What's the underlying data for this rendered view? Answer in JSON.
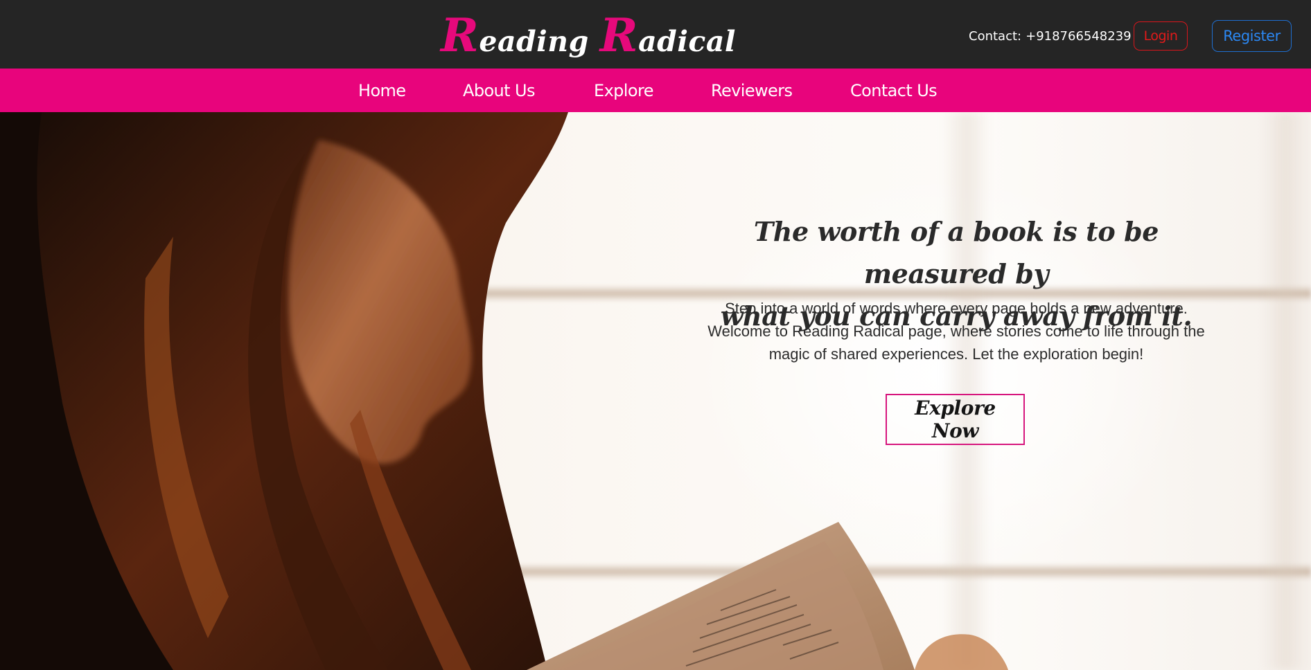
{
  "header": {
    "logo": {
      "word1_cap": "R",
      "word1_rest": "eading",
      "word2_cap": "R",
      "word2_rest": "adical"
    },
    "contact": {
      "label": "Contact:",
      "phone": "+918766548239"
    },
    "login_label": "Login",
    "register_label": "Register"
  },
  "nav": {
    "items": [
      {
        "label": "Home"
      },
      {
        "label": "About Us"
      },
      {
        "label": "Explore"
      },
      {
        "label": "Reviewers"
      },
      {
        "label": "Contact Us"
      }
    ]
  },
  "hero": {
    "quote_line1": "The worth of a book is to be measured by",
    "quote_line2": "what you can carry away from it.",
    "tagline_line1": "Step into a world of words where every page holds a new adventure.",
    "tagline_line2": "Welcome to Reading Radical page, where stories come to life through the",
    "tagline_line3": "magic of shared experiences. Let the exploration begin!",
    "cta_label": "Explore Now",
    "image": "woman-reading-book-photo"
  },
  "colors": {
    "header_bg": "#252525",
    "brand_pink": "#e8047c",
    "login_red": "#e31a1a",
    "register_blue": "#2b87f2"
  }
}
